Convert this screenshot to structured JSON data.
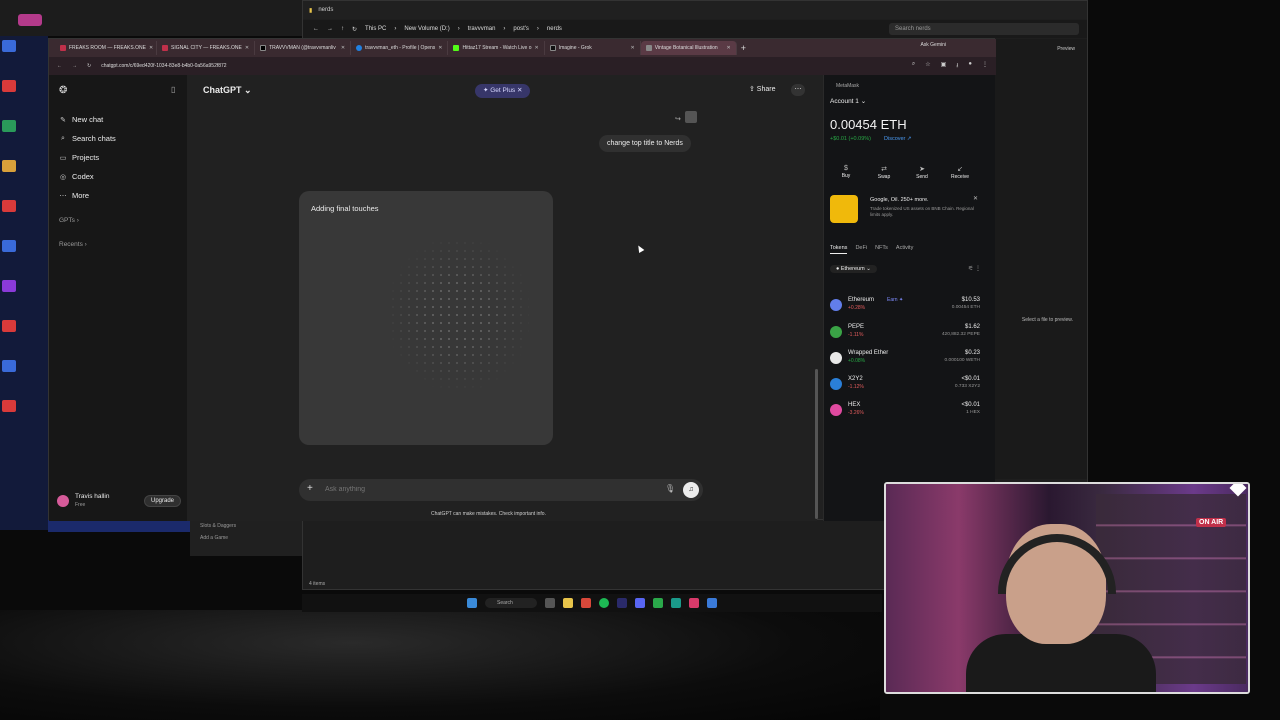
{
  "explorer": {
    "title": "nerds",
    "breadcrumb": [
      "This PC",
      "New Volume (D:)",
      "travvvman",
      "post's",
      "nerds"
    ],
    "search_placeholder": "Search nerds",
    "preview_label": "Preview",
    "preview_text": "Select a file to preview.",
    "status": "4 items"
  },
  "behind_window": {
    "item1": "Slots & Daggers",
    "item2": "Add a Game"
  },
  "taskbar": {
    "search": "Search"
  },
  "browser": {
    "tabs": [
      {
        "label": "FREAKS ROOM — FREAKS.ONE",
        "color": "#c0304a"
      },
      {
        "label": "SIGNAL CITY — FREAKS.ONE",
        "color": "#c0304a"
      },
      {
        "label": "TRAVVVMAN (@travvvmanliv",
        "color": "#000000"
      },
      {
        "label": "travvvman_eth - Profile | Opens",
        "color": "#2081e2"
      },
      {
        "label": "Hittaz17 Stream - Watch Live o",
        "color": "#53fc18"
      },
      {
        "label": "Imagine - Grok",
        "color": "#111111"
      },
      {
        "label": "Vintage Botanical Illustration",
        "color": "#888888",
        "active": true
      }
    ],
    "new_tab": "+",
    "ask_gemini": "Ask Gemini",
    "url": "chatgpt.com/c/69ed420f-1034-83e8-b4b0-0a56a952f872"
  },
  "chatgpt": {
    "sidebar": {
      "items": [
        {
          "icon": "✎",
          "label": "New chat"
        },
        {
          "icon": "⌕",
          "label": "Search chats"
        },
        {
          "icon": "▭",
          "label": "Projects"
        },
        {
          "icon": "◎",
          "label": "Codex"
        },
        {
          "icon": "⋯",
          "label": "More"
        }
      ],
      "gpts": "GPTs ›",
      "recents": "Recents ›",
      "user_name": "Travis hallin",
      "user_plan": "Free",
      "upgrade": "Upgrade"
    },
    "header": {
      "model": "ChatGPT ⌄",
      "get_plus": "✦ Get Plus ✕",
      "share": "⇪ Share",
      "more": "⋯"
    },
    "user_message": "change top title to Nerds",
    "image_card_title": "Adding final touches",
    "composer": {
      "placeholder": "Ask anything"
    },
    "disclaimer": "ChatGPT can make mistakes. Check important info."
  },
  "metamask": {
    "header": "MetaMask",
    "account": "Account 1 ⌄",
    "balance": "0.00454 ETH",
    "change": "+$0.01 (+0.09%)",
    "discover": "Discover ↗",
    "actions": [
      {
        "icon": "$",
        "label": "Buy"
      },
      {
        "icon": "⇄",
        "label": "Swap"
      },
      {
        "icon": "➤",
        "label": "Send"
      },
      {
        "icon": "↙",
        "label": "Receive"
      }
    ],
    "promo": {
      "title": "Google, Oil. 250+ more.",
      "subtitle": "Trade tokenized US assets on BNB Chain. Regional limits apply.",
      "close": "✕"
    },
    "tabs": [
      "Tokens",
      "DeFi",
      "NFTs",
      "Activity"
    ],
    "network": "● Ethereum ⌄",
    "tokens": [
      {
        "name": "Ethereum",
        "earn": "Earn ✦",
        "pct": "+0.28%",
        "usd": "$10.53",
        "amount": "0.00454 ETH",
        "color": "#627eea",
        "pct_color": "#e25c5c"
      },
      {
        "name": "PEPE",
        "earn": "",
        "pct": "-1.11%",
        "usd": "$1.62",
        "amount": "420,882.32 PEPE",
        "color": "#3aa346",
        "pct_color": "#e25c5c"
      },
      {
        "name": "Wrapped Ether",
        "earn": "",
        "pct": "+0.08%",
        "usd": "$0.23",
        "amount": "0.000100 WETH",
        "color": "#e8e8e8",
        "pct_color": "#28a745"
      },
      {
        "name": "X2Y2",
        "earn": "",
        "pct": "-1.12%",
        "usd": "<$0.01",
        "amount": "0.733 X2Y2",
        "color": "#2a7fd8",
        "pct_color": "#e25c5c"
      },
      {
        "name": "HEX",
        "earn": "",
        "pct": "-3.26%",
        "usd": "<$0.01",
        "amount": "1 HEX",
        "color": "#e04aa0",
        "pct_color": "#e25c5c"
      }
    ]
  },
  "webcam": {
    "on_air": "ON AIR"
  }
}
